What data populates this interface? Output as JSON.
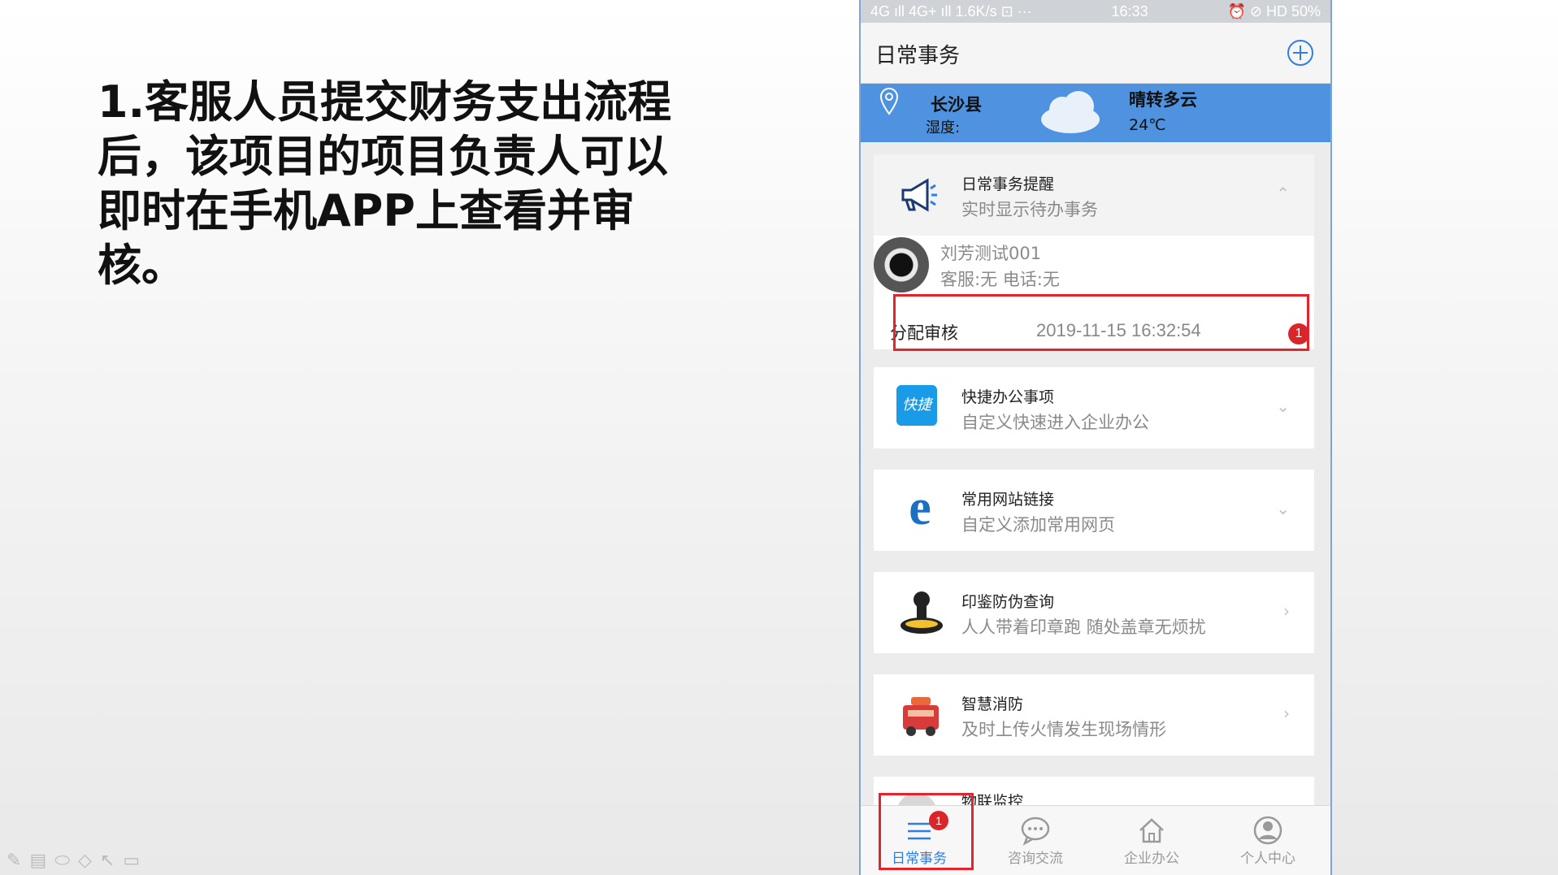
{
  "slide": {
    "headline": "1.客服人员提交财务支出流程后，该项目的项目负责人可以即时在手机APP上查看并审核。"
  },
  "status_bar": {
    "left": "4G ıll 4G+ ıll 1.6K/s ⊡ ···",
    "time": "16:33",
    "right": "⏰ ⊘ HD 50%"
  },
  "nav": {
    "title": "日常事务"
  },
  "weather": {
    "city": "长沙县",
    "humidity_label": "湿度:",
    "condition": "晴转多云",
    "temperature": "24℃"
  },
  "reminder": {
    "title": "日常事务提醒",
    "subtitle": "实时显示待办事务",
    "chevron": "⌃"
  },
  "message": {
    "name": "刘芳测试001",
    "info": "客服:无 电话:无"
  },
  "task": {
    "label": "分配审核",
    "time": "2019-11-15 16:32:54",
    "badge": "1"
  },
  "cards": [
    {
      "title": "快捷办公事项",
      "subtitle": "自定义快速进入企业办公",
      "icon_text": "快捷",
      "chevron": "⌄"
    },
    {
      "title": "常用网站链接",
      "subtitle": "自定义添加常用网页",
      "icon_text": "e",
      "chevron": "⌄"
    },
    {
      "title": "印鉴防伪查询",
      "subtitle": "人人带着印章跑 随处盖章无烦扰",
      "chevron": "›"
    },
    {
      "title": "智慧消防",
      "subtitle": "及时上传火情发生现场情形",
      "chevron": "›"
    },
    {
      "title": "物联监控"
    }
  ],
  "tabs": [
    {
      "label": "日常事务",
      "badge": "1",
      "icon": "list-icon"
    },
    {
      "label": "咨询交流",
      "icon": "chat-icon"
    },
    {
      "label": "企业办公",
      "icon": "home-icon"
    },
    {
      "label": "个人中心",
      "icon": "user-icon"
    }
  ],
  "colors": {
    "accent": "#2f7ee0",
    "weather_bg": "#4e92e0",
    "highlight": "#e8222b",
    "badge": "#d9262b"
  }
}
